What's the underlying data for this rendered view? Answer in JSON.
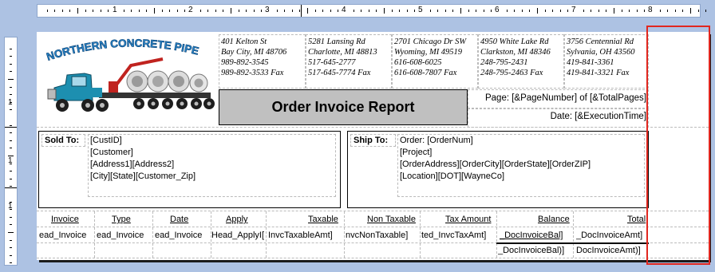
{
  "ruler": {
    "numbers": [
      "1",
      "2",
      "3",
      "4",
      "5",
      "6",
      "7",
      "8"
    ],
    "v_numbers": [
      "1",
      "1",
      "1"
    ]
  },
  "logo": {
    "text": "NORTHERN CONCRETE PIPE"
  },
  "addresses": [
    {
      "line1": "401 Kelton St",
      "line2": "Bay City, MI 48706",
      "line3": "989-892-3545",
      "line4": "989-892-3533 Fax"
    },
    {
      "line1": "5281 Lansing Rd",
      "line2": "Charlotte, MI 48813",
      "line3": "517-645-2777",
      "line4": "517-645-7774 Fax"
    },
    {
      "line1": "2701 Chicago Dr SW",
      "line2": "Wyoming, MI 49519",
      "line3": "616-608-6025",
      "line4": "616-608-7807 Fax"
    },
    {
      "line1": "4950 White Lake Rd",
      "line2": "Clarkston, MI 48346",
      "line3": "248-795-2431",
      "line4": "248-795-2463 Fax"
    },
    {
      "line1": "3756 Centennial Rd",
      "line2": "Sylvania, OH 43560",
      "line3": "419-841-3361",
      "line4": "419-841-3321 Fax"
    }
  ],
  "report": {
    "title": "Order Invoice Report",
    "page_text": "Page: [&PageNumber] of [&TotalPages]",
    "date_text": "Date: [&ExecutionTime]"
  },
  "sold_to": {
    "label": "Sold To:",
    "lines": [
      "[CustID]",
      "[Customer]",
      "[Address1][Address2]",
      "[City][State][Customer_Zip]"
    ]
  },
  "ship_to": {
    "label": "Ship To:",
    "lines": [
      "Order: [OrderNum]",
      "[Project]",
      "[OrderAddress][OrderCity][OrderState][OrderZIP]",
      "[Location][DOT][WayneCo]"
    ]
  },
  "table": {
    "headers": [
      "Invoice",
      "Type",
      "Date",
      "Apply",
      "Taxable",
      "Non Taxable",
      "Tax Amount",
      "Balance",
      "Total"
    ],
    "row": [
      "ead_Invoice",
      "ead_Invoice",
      "ead_Invoice",
      "Head_ApplyI[",
      "InvcTaxableAmt]",
      "nvcNonTaxable]",
      "ted_InvcTaxAmt]",
      "_DocInvoiceBal]",
      "_DocInvoiceAmt]"
    ],
    "totals": [
      "_DocInvoiceBal)]",
      "DocInvoiceAmt)]"
    ]
  }
}
